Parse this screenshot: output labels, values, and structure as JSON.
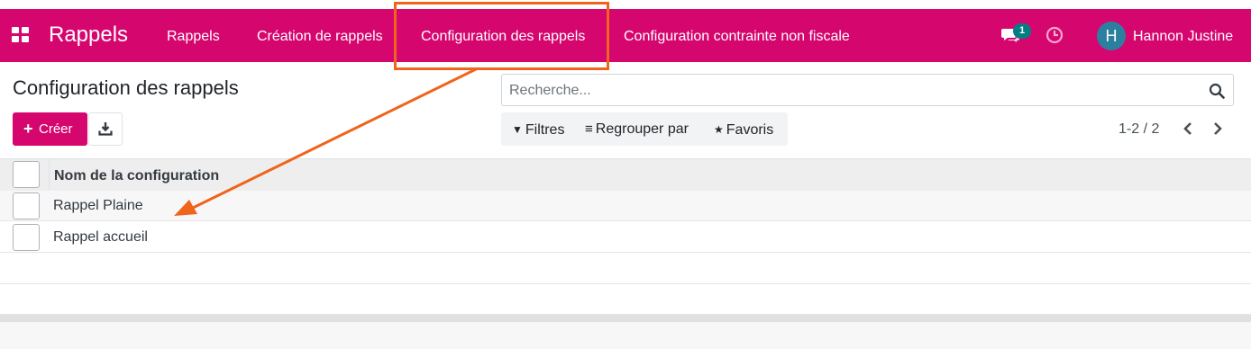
{
  "navbar": {
    "brand": "Rappels",
    "menu": [
      {
        "label": "Rappels"
      },
      {
        "label": "Création de rappels"
      },
      {
        "label": "Configuration des rappels"
      },
      {
        "label": "Configuration contrainte non fiscale"
      }
    ],
    "messages_badge": "1",
    "user": {
      "initial": "H",
      "name": "Hannon Justine"
    }
  },
  "control_panel": {
    "title": "Configuration des rappels",
    "search_placeholder": "Recherche...",
    "create_label": "Créer",
    "filters": {
      "filters_label": "Filtres",
      "group_by_label": "Regrouper par",
      "favorites_label": "Favoris"
    },
    "pager": "1-2 / 2"
  },
  "list": {
    "column_header": "Nom de la configuration",
    "rows": [
      {
        "name": "Rappel Plaine"
      },
      {
        "name": "Rappel accueil"
      }
    ]
  },
  "colors": {
    "brand": "#d6066f",
    "annotation": "#f0641c",
    "badge": "#017e84",
    "avatar": "#2d7fa0"
  },
  "icons": [
    "apps-grid-icon",
    "chat-icon",
    "clock-icon",
    "search-icon",
    "plus-icon",
    "download-icon",
    "filter-icon",
    "list-icon",
    "star-icon",
    "chevron-left-icon",
    "chevron-right-icon"
  ]
}
